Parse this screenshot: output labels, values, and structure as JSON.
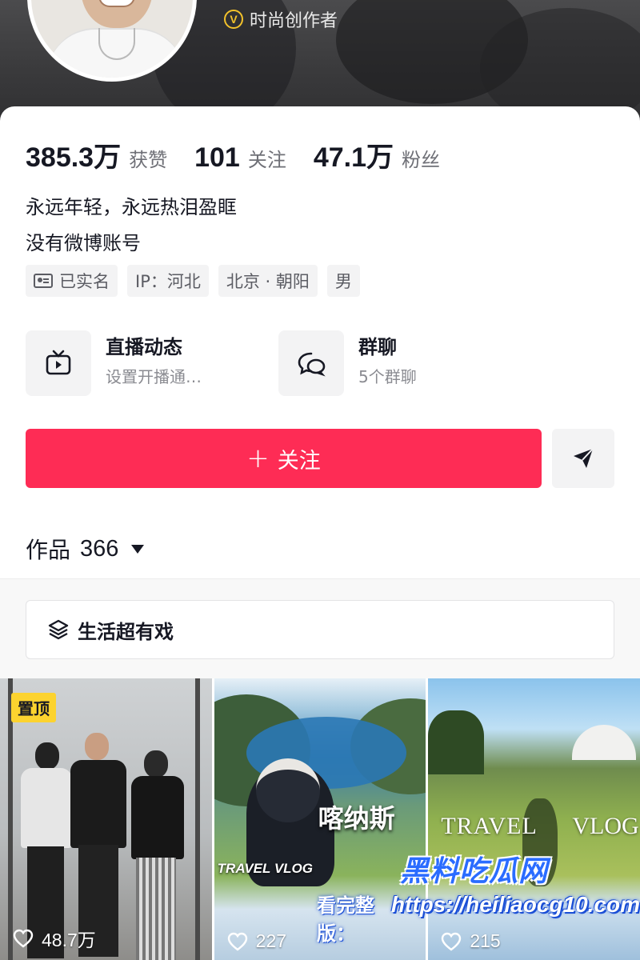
{
  "profile": {
    "creator_tag": "时尚创作者",
    "creator_badge_letter": "V"
  },
  "stats": [
    {
      "value": "385.3万",
      "label": "获赞"
    },
    {
      "value": "101",
      "label": "关注"
    },
    {
      "value": "47.1万",
      "label": "粉丝"
    }
  ],
  "bio": {
    "line1": "永远年轻，永远热泪盈眶",
    "line2": "没有微博账号"
  },
  "tags": {
    "verified": "已实名",
    "ip": "IP：河北",
    "location": "北京 · 朝阳",
    "gender": "男"
  },
  "features": {
    "live": {
      "title": "直播动态",
      "subtitle": "设置开播通…",
      "icon": "tv-icon"
    },
    "group": {
      "title": "群聊",
      "subtitle": "5个群聊",
      "icon": "chat-bubbles-icon"
    }
  },
  "actions": {
    "follow_plus": "+",
    "follow_label": "关注",
    "share_icon": "send-icon",
    "accent_color": "#fe2c55"
  },
  "works": {
    "label": "作品",
    "count": "366"
  },
  "collection": {
    "label": "生活超有戏",
    "icon": "stack-layers-icon"
  },
  "videos": [
    {
      "pinned_label": "置顶",
      "likes": "48.7万"
    },
    {
      "overlay_title": "喀纳斯",
      "overlay_sub": "TRAVEL VLOG",
      "likes": "227"
    },
    {
      "overlay_left": "TRAVEL",
      "overlay_right": "VLOG",
      "likes": "215"
    }
  ],
  "watermark": {
    "brand": "黑料吃瓜网",
    "label": "看完整版：",
    "url": "https://heiliaocg10.com"
  }
}
